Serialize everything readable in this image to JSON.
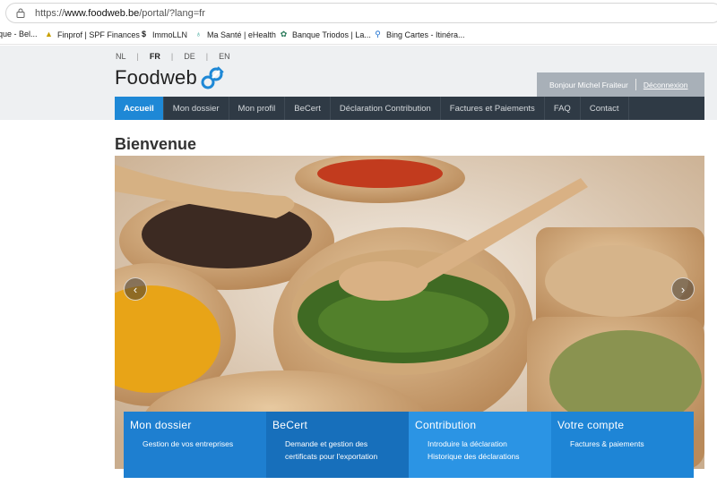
{
  "browser": {
    "url_prefix": "https://",
    "url_domain": "www.foodweb.be",
    "url_path": "/portal/?lang=fr",
    "bookmarks": [
      {
        "label": "que - Bel...",
        "icon": "bookmark-icon"
      },
      {
        "label": "Finprof | SPF Finances",
        "icon": "finprof-icon"
      },
      {
        "label": "ImmoLLN",
        "icon": "dollar-icon"
      },
      {
        "label": "Ma Santé | eHealth",
        "icon": "ehealth-icon"
      },
      {
        "label": "Banque Triodos | La...",
        "icon": "triodos-icon"
      },
      {
        "label": "Bing Cartes - Itinéra...",
        "icon": "bing-search-icon"
      }
    ]
  },
  "header": {
    "languages": [
      "NL",
      "FR",
      "DE",
      "EN"
    ],
    "active_language": "FR",
    "logo_text": "Foodweb",
    "greeting": "Bonjour Michel Fraiteur",
    "logout_label": "Déconnexion"
  },
  "nav": {
    "items": [
      "Accueil",
      "Mon dossier",
      "Mon profil",
      "BeCert",
      "Déclaration Contribution",
      "Factures et Paiements",
      "FAQ",
      "Contact"
    ],
    "active": "Accueil"
  },
  "main": {
    "title": "Bienvenue",
    "carousel": {
      "prev_icon": "chevron-left-icon",
      "next_icon": "chevron-right-icon"
    },
    "tiles": [
      {
        "title": "Mon dossier",
        "lines": [
          "Gestion de vos entreprises"
        ]
      },
      {
        "title": "BeCert",
        "lines": [
          "Demande et gestion des",
          "certificats pour l'exportation"
        ]
      },
      {
        "title": "Contribution",
        "lines": [
          "Introduire la déclaration",
          "Historique des déclarations"
        ]
      },
      {
        "title": "Votre compte",
        "lines": [
          "Factures & paiements"
        ]
      }
    ]
  },
  "colors": {
    "nav_bg": "#2f3a45",
    "accent": "#1e88d6",
    "header_bg": "#eef0f2",
    "userbox_bg": "#a8b0b8"
  }
}
